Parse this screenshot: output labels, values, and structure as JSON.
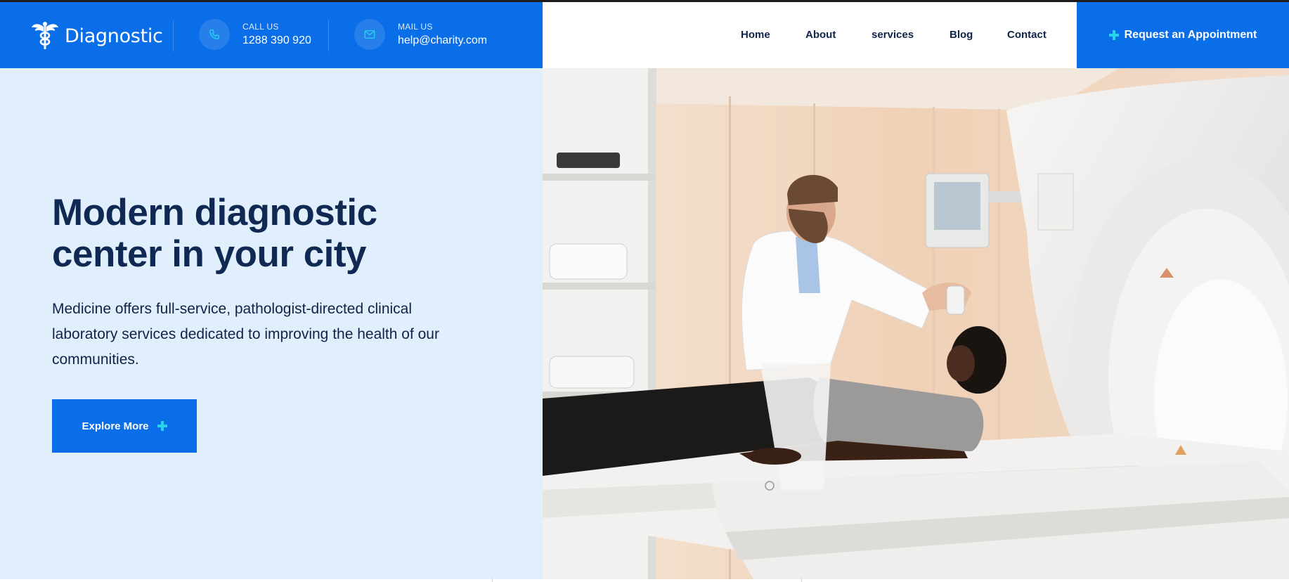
{
  "brand": {
    "name": "Diagnostic",
    "logo_icon": "caduceus-icon"
  },
  "header": {
    "call": {
      "label": "CALL US",
      "value": "1288 390 920",
      "icon": "phone-icon"
    },
    "mail": {
      "label": "MAIL US",
      "value": "help@charity.com",
      "icon": "mail-icon"
    },
    "nav": [
      {
        "label": "Home"
      },
      {
        "label": "About"
      },
      {
        "label": "services"
      },
      {
        "label": "Blog"
      },
      {
        "label": "Contact"
      }
    ],
    "cta_label": "Request an Appointment"
  },
  "hero": {
    "title_line1": "Modern diagnostic",
    "title_line2": "center in your city",
    "description": "Medicine offers full-service, pathologist-directed clinical laboratory services dedicated to improving the health of our communities.",
    "button_label": "Explore More"
  },
  "colors": {
    "primary": "#0a6ee8",
    "accent": "#26d4ee",
    "hero_bg": "#e1eefc",
    "heading": "#0f2952"
  }
}
